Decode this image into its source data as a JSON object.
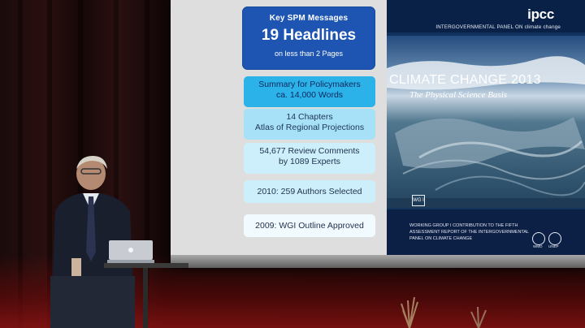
{
  "slide": {
    "headline_box": {
      "line1": "Key SPM Messages",
      "line2": "19 Headlines",
      "line3": "on less than 2 Pages"
    },
    "boxes": [
      {
        "text": "Summary for Policymakers\nca. 14,000 Words",
        "style": "cyan"
      },
      {
        "text": "14 Chapters\nAtlas of Regional Projections",
        "style": "light"
      },
      {
        "text": "54,677 Review Comments\nby 1089 Experts",
        "style": "pale"
      },
      {
        "text": "2010: 259 Authors Selected",
        "style": "pale"
      },
      {
        "text": "2009: WGI Outline Approved",
        "style": "white"
      }
    ]
  },
  "cover": {
    "logo": "ipcc",
    "subtitle": "INTERGOVERNMENTAL PANEL ON climate change",
    "title": "CLIMATE CHANGE 2013",
    "tagline": "The Physical Science Basis",
    "wg_badge": "WG I",
    "contribution": "WORKING GROUP I CONTRIBUTION TO THE FIFTH ASSESSMENT REPORT OF THE INTERGOVERNMENTAL PANEL ON CLIMATE CHANGE",
    "org_labels": [
      "WMO",
      "UNEP"
    ]
  },
  "colors": {
    "headline_blue": "#1e55b3",
    "box_cyan": "#2bb2e8",
    "cover_navy": "#0e2852",
    "stage_red": "#a01414"
  }
}
